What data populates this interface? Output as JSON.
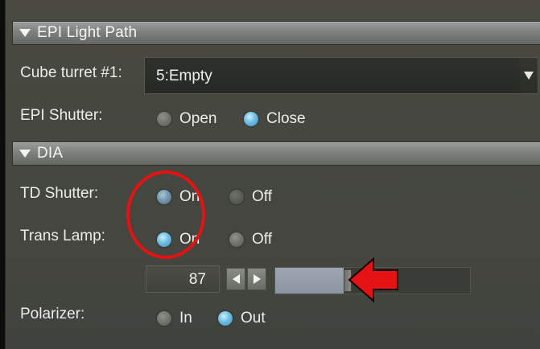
{
  "epi": {
    "header": "EPI Light Path",
    "cube_turret_label": "Cube turret #1:",
    "cube_turret_value": "5:Empty",
    "shutter_label": "EPI Shutter:",
    "shutter_open": "Open",
    "shutter_close": "Close",
    "shutter_selected": "Close"
  },
  "dia": {
    "header": "DIA",
    "td_shutter_label": "TD Shutter:",
    "td_on": "On",
    "td_off": "Off",
    "td_selected": "On",
    "trans_lamp_label": "Trans Lamp:",
    "lamp_on": "On",
    "lamp_off": "Off",
    "lamp_selected": "On",
    "lamp_intensity": "87",
    "lamp_slider_fraction": 0.35,
    "polarizer_label": "Polarizer:",
    "pol_in": "In",
    "pol_out": "Out",
    "pol_selected": "Out"
  },
  "icons": {
    "section_toggle": "triangle-down-icon",
    "dropdown": "chevron-down-icon",
    "step_left": "arrow-left-icon",
    "step_right": "arrow-right-icon"
  },
  "colors": {
    "radio_selected": "#6dbde4",
    "annotation": "#e41212"
  }
}
